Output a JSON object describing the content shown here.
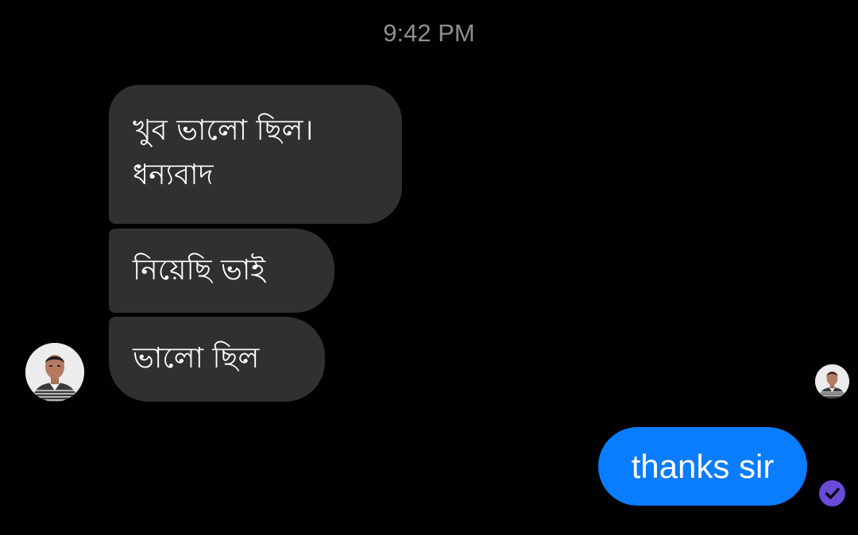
{
  "conversation": {
    "timestamp": "9:42 PM",
    "messages": [
      {
        "id": "m1",
        "direction": "incoming",
        "text": "খুব ভালো  ছিল।\nধন্যবাদ"
      },
      {
        "id": "m2",
        "direction": "incoming",
        "text": "নিয়েছি  ভাই"
      },
      {
        "id": "m3",
        "direction": "incoming",
        "text": "ভালো  ছিল"
      },
      {
        "id": "m4",
        "direction": "outgoing",
        "text": "thanks sir"
      }
    ],
    "sender_avatar_icon": "user-avatar-photo",
    "seen_avatar_icon": "seen-by-avatar-photo",
    "status_icon": "delivered-check-icon"
  },
  "colors": {
    "background": "#000000",
    "incoming_bubble": "#303030",
    "outgoing_bubble": "#0a7cff",
    "timestamp_text": "#8e8e93",
    "status_check": "#6a4bd8"
  }
}
